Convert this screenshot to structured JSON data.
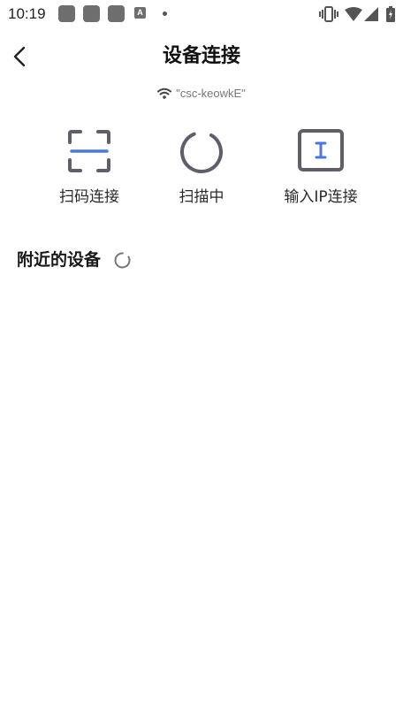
{
  "status_bar": {
    "time": "10:19",
    "notification_badge": "A"
  },
  "header": {
    "title": "设备连接"
  },
  "wifi": {
    "name": "\"csc-keowkE\""
  },
  "actions": [
    {
      "label": "扫码连接",
      "icon": "scan-icon"
    },
    {
      "label": "扫描中",
      "icon": "scanning-spinner-icon"
    },
    {
      "label": "输入IP连接",
      "icon": "ip-input-icon"
    }
  ],
  "nearby": {
    "title": "附近的设备"
  },
  "colors": {
    "accent": "#4a78e0",
    "icon_gray": "#5f5f6b"
  }
}
